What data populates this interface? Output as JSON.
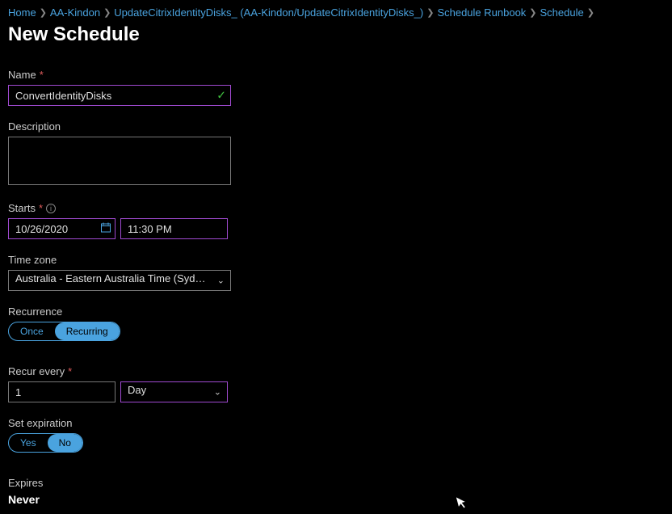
{
  "breadcrumb": {
    "home": "Home",
    "aa": "AA-Kindon",
    "update": "UpdateCitrixIdentityDisks_ (AA-Kindon/UpdateCitrixIdentityDisks_)",
    "sched_rb": "Schedule Runbook",
    "sched": "Schedule"
  },
  "page_title": "New Schedule",
  "labels": {
    "name": "Name",
    "desc": "Description",
    "starts": "Starts",
    "tz": "Time zone",
    "rec": "Recurrence",
    "recur_every": "Recur every",
    "set_exp": "Set expiration",
    "expires": "Expires"
  },
  "values": {
    "name": "ConvertIdentityDisks",
    "date": "10/26/2020",
    "time": "11:30 PM",
    "tz": "Australia - Eastern Australia Time (Sydn...",
    "recur_num": "1",
    "recur_unit": "Day",
    "expires": "Never"
  },
  "toggles": {
    "once": "Once",
    "recurring": "Recurring",
    "yes": "Yes",
    "no": "No"
  }
}
